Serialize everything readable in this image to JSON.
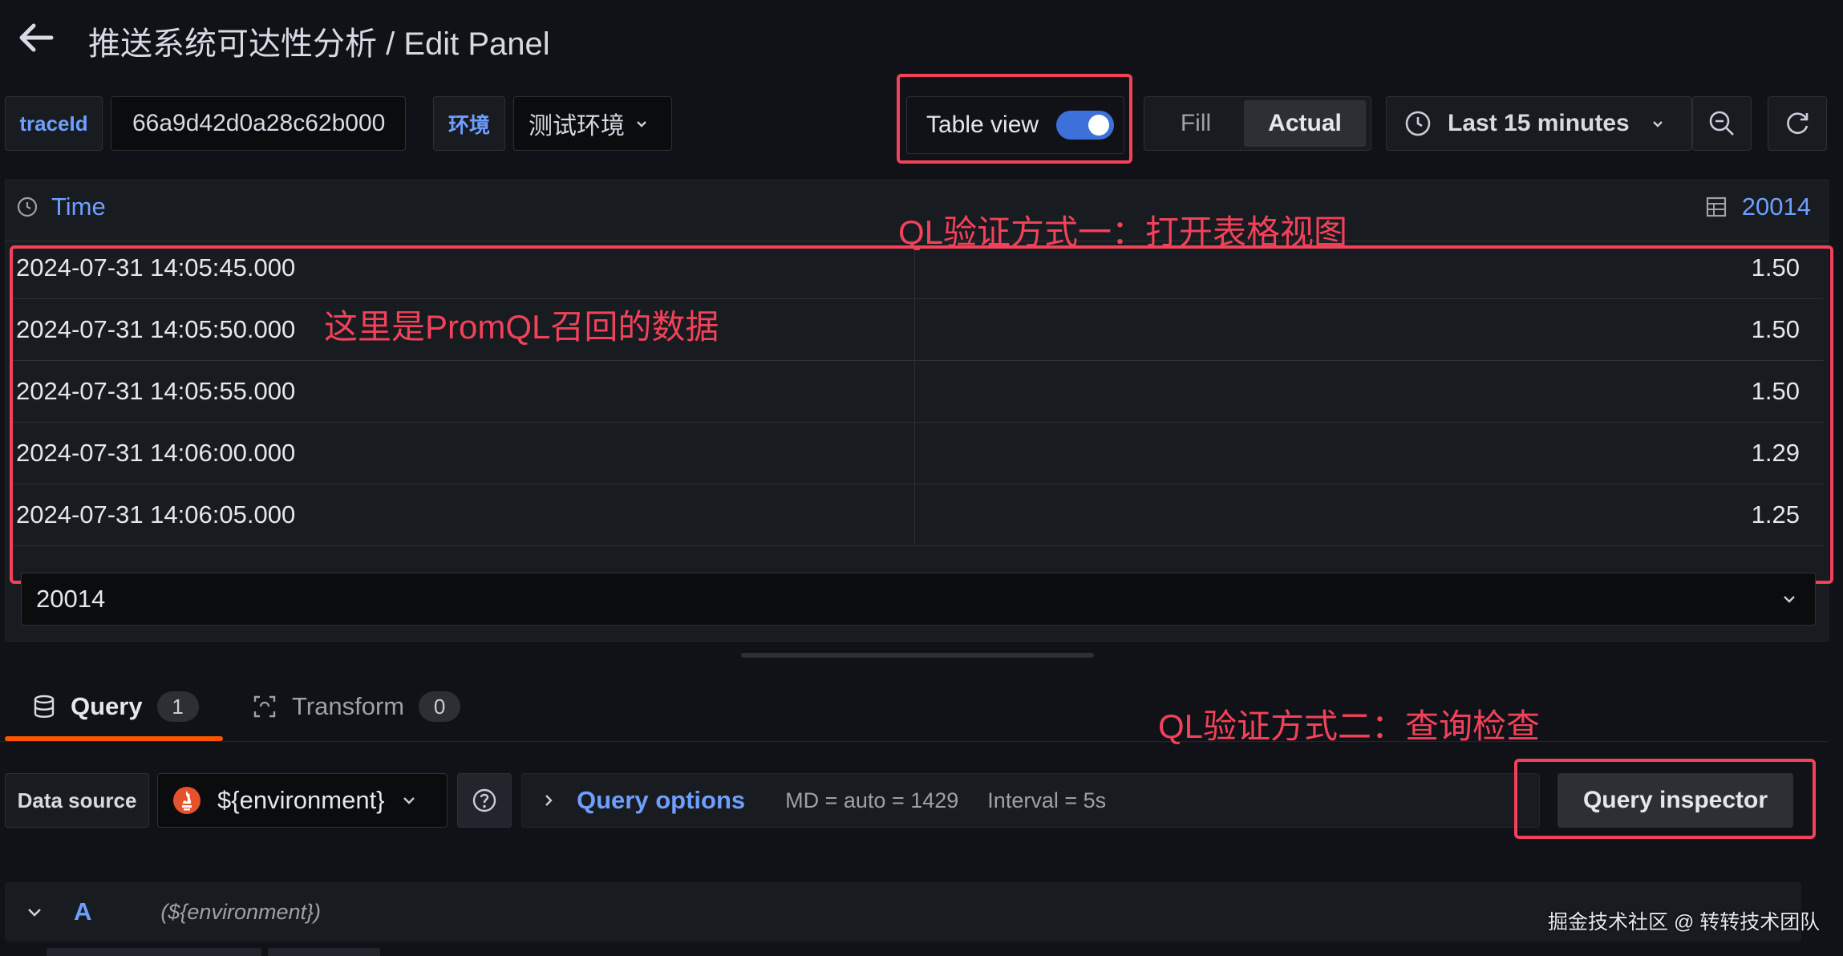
{
  "header": {
    "title": "推送系统可达性分析 / Edit Panel"
  },
  "toolbar": {
    "traceid_label": "traceId",
    "traceid_value": "66a9d42d0a28c62b000",
    "env_label": "环境",
    "env_value": "测试环境",
    "table_view_label": "Table view",
    "table_view_on": true,
    "fill_label": "Fill",
    "actual_label": "Actual",
    "time_range": "Last 15 minutes"
  },
  "table": {
    "time_header": "Time",
    "value_header": "20014",
    "rows": [
      {
        "time": "2024-07-31 14:05:45.000",
        "value": "1.50"
      },
      {
        "time": "2024-07-31 14:05:50.000",
        "value": "1.50"
      },
      {
        "time": "2024-07-31 14:05:55.000",
        "value": "1.50"
      },
      {
        "time": "2024-07-31 14:06:00.000",
        "value": "1.29"
      },
      {
        "time": "2024-07-31 14:06:05.000",
        "value": "1.25"
      }
    ],
    "series_select": "20014"
  },
  "annotations": {
    "method_one": "QL验证方式一：打开表格视图",
    "promql_data": "这里是PromQL召回的数据",
    "method_two": "QL验证方式二：查询检查"
  },
  "tabs": [
    {
      "label": "Query",
      "count": "1"
    },
    {
      "label": "Transform",
      "count": "0"
    }
  ],
  "query": {
    "datasource_label": "Data source",
    "datasource_value": "${environment}",
    "options_label": "Query options",
    "md": "MD = auto = 1429",
    "interval": "Interval = 5s",
    "inspector_label": "Query inspector",
    "row_letter": "A",
    "row_source": "(${environment})"
  },
  "watermark": "掘金技术社区 @ 转转技术团队",
  "colors": {
    "accent": "#6e9fff",
    "annotation_red": "#f1425a",
    "tab_underline": "#ff5500",
    "toggle_on": "#3d71d9"
  }
}
